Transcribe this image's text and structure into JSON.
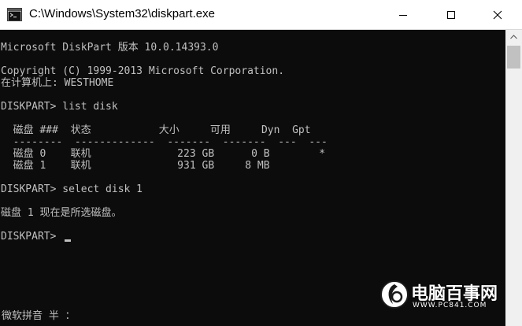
{
  "window": {
    "title": "C:\\Windows\\System32\\diskpart.exe"
  },
  "console": {
    "lines": [
      "Microsoft DiskPart 版本 10.0.14393.0",
      "Copyright (C) 1999-2013 Microsoft Corporation.",
      "在计算机上: WESTHOME",
      "DISKPART> list disk",
      "  磁盘 ###  状态           大小     可用     Dyn  Gpt",
      "  --------  -------------  -------  -------  ---  ---",
      "  磁盘 0    联机              223 GB      0 B        *",
      "  磁盘 1    联机              931 GB     8 MB",
      "DISKPART> select disk 1",
      "磁盘 1 现在是所选磁盘。",
      "DISKPART> "
    ]
  },
  "ime": {
    "status": "微软拼音 半 ："
  },
  "watermark": {
    "name": "电脑百事网",
    "url": "WWW.PC841.COM"
  },
  "colors": {
    "console_bg": "#0c0c0c",
    "console_fg": "#c0c0c0",
    "titlebar_bg": "#ffffff",
    "scrollbar_bg": "#f0f0f0",
    "scrollbar_thumb": "#c1c1c1"
  }
}
